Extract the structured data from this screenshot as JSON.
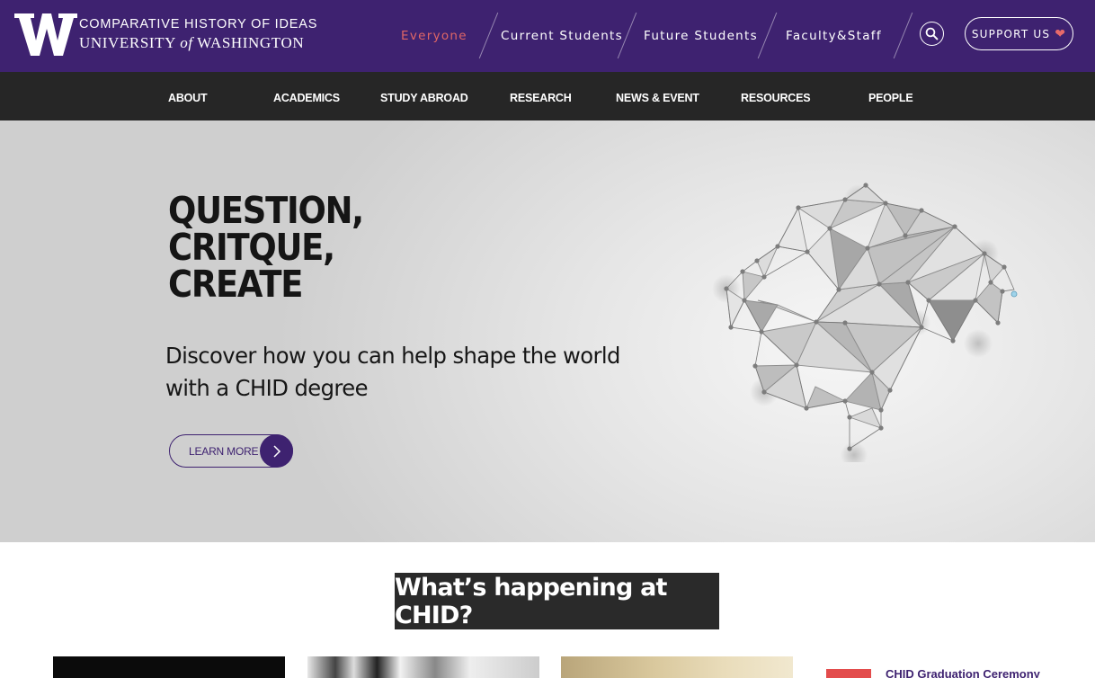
{
  "header": {
    "logo": {
      "icon": "uw-w-logo",
      "line1": "COMPARATIVE HISTORY OF IDEAS",
      "line2_pre": "UNIVERSITY ",
      "line2_of": "of",
      "line2_post": " WASHINGTON"
    },
    "audience_links": [
      {
        "label": "Everyone",
        "active": true
      },
      {
        "label": "Current Students",
        "active": false
      },
      {
        "label": "Future Students",
        "active": false
      },
      {
        "label": "Faculty&Staff",
        "active": false
      }
    ],
    "search_icon": "search-icon",
    "support_label": "SUPPORT US",
    "support_icon": "heart-icon"
  },
  "nav": {
    "items": [
      "ABOUT",
      "ACADEMICS",
      "STUDY ABROAD",
      "RESEARCH",
      "NEWS & EVENT",
      "RESOURCES",
      "PEOPLE"
    ]
  },
  "hero": {
    "headline": [
      "QUESTION,",
      "CRITQUE,",
      "CREATE"
    ],
    "subtext": "Discover how you can help shape the world with a CHID degree",
    "cta_label": "LEARN MORE",
    "cta_icon": "chevron-right-icon",
    "illustration": "polygon-brain-illustration"
  },
  "section": {
    "title": "What’s happening at CHID?",
    "cards": [
      {
        "title": ""
      },
      {
        "title": ""
      },
      {
        "title": ""
      },
      {
        "title": "CHID Graduation Ceremony"
      }
    ]
  },
  "colors": {
    "brand_purple": "#3e2270",
    "nav_dark": "#262626",
    "accent_red": "#e06666"
  }
}
